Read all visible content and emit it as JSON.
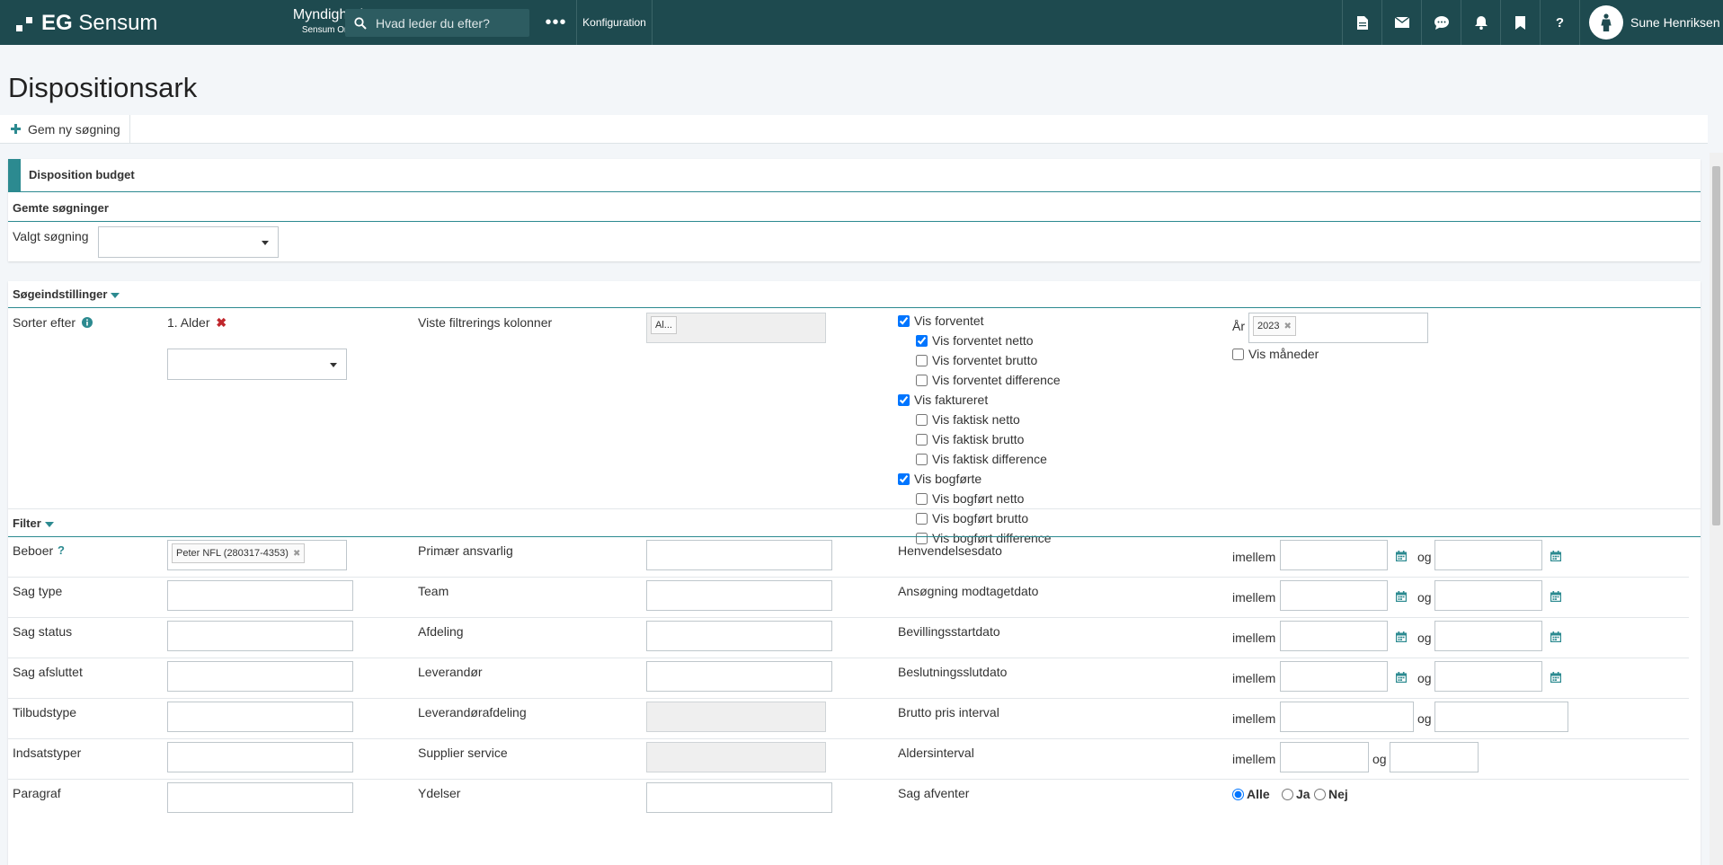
{
  "app": {
    "logo_prefix": "EG",
    "logo_name": "Sensum",
    "context_title": "Myndighed",
    "context_sub": "Sensum One",
    "search_placeholder": "Hvad leder du efter?",
    "more_label": "•••",
    "konfig_label": "Konfiguration",
    "user_name": "Sune Henriksen"
  },
  "page": {
    "title": "Dispositionsark",
    "save_search_label": "Gem ny søgning"
  },
  "disposition": {
    "title": "Disposition budget",
    "saved_title": "Gemte søgninger",
    "selected_label": "Valgt søgning",
    "selected_value": ""
  },
  "settings": {
    "title": "Søgeindstillinger",
    "sort_label": "Sorter efter",
    "sort_item": "1. Alder",
    "shown_filter_label": "Viste filtrerings kolonner",
    "shown_filter_tag": "Al...",
    "year_label": "År",
    "year_tag": "2023",
    "vis_maaneder": "Vis måneder",
    "checks": [
      {
        "label": "Vis forventet",
        "checked": true,
        "indent": false
      },
      {
        "label": "Vis forventet netto",
        "checked": true,
        "indent": true
      },
      {
        "label": "Vis forventet brutto",
        "checked": false,
        "indent": true
      },
      {
        "label": "Vis forventet difference",
        "checked": false,
        "indent": true
      },
      {
        "label": "Vis faktureret",
        "checked": true,
        "indent": false
      },
      {
        "label": "Vis faktisk netto",
        "checked": false,
        "indent": true
      },
      {
        "label": "Vis faktisk brutto",
        "checked": false,
        "indent": true
      },
      {
        "label": "Vis faktisk difference",
        "checked": false,
        "indent": true
      },
      {
        "label": "Vis bogførte",
        "checked": true,
        "indent": false
      },
      {
        "label": "Vis bogført netto",
        "checked": false,
        "indent": true
      },
      {
        "label": "Vis bogført brutto",
        "checked": false,
        "indent": true
      },
      {
        "label": "Vis bogført difference",
        "checked": false,
        "indent": true
      }
    ]
  },
  "filter": {
    "title": "Filter",
    "beboer_help": "?",
    "beboer_tag": "Peter NFL (280317-4353)",
    "between": "imellem",
    "and": "og",
    "radio_all": "Alle",
    "radio_yes": "Ja",
    "radio_no": "Nej",
    "rows": [
      {
        "c1": "Beboer",
        "c2": "Primær ansvarlig",
        "c3": "Henvendelsesdato"
      },
      {
        "c1": "Sag type",
        "c2": "Team",
        "c3": "Ansøgning modtagetdato"
      },
      {
        "c1": "Sag status",
        "c2": "Afdeling",
        "c3": "Bevillingsstartdato"
      },
      {
        "c1": "Sag afsluttet",
        "c2": "Leverandør",
        "c3": "Beslutningsslutdato"
      },
      {
        "c1": "Tilbudstype",
        "c2": "Leverandørafdeling",
        "c3": "Brutto pris interval"
      },
      {
        "c1": "Indsatstyper",
        "c2": "Supplier service",
        "c3": "Aldersinterval"
      },
      {
        "c1": "Paragraf",
        "c2": "Ydelser",
        "c3": "Sag afventer"
      }
    ]
  }
}
